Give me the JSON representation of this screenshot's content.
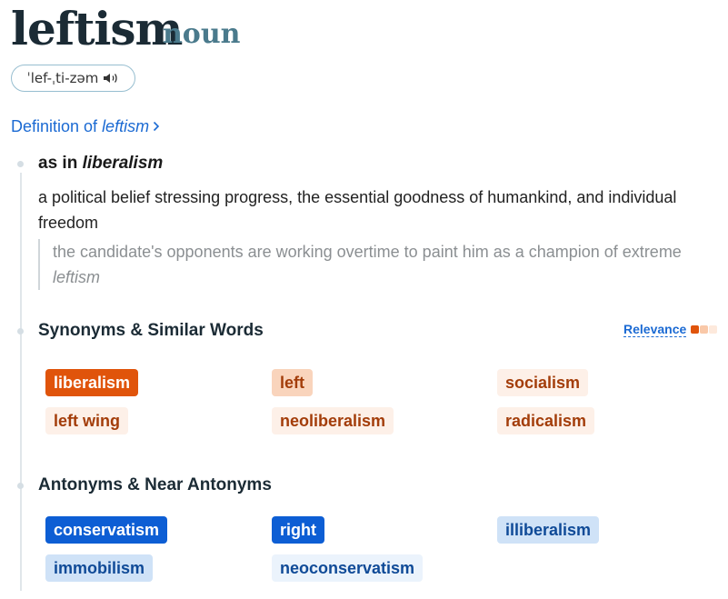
{
  "entry": {
    "headword": "leftism",
    "part_of_speech": "noun",
    "pronunciation": "ˈlef-ˌti-zəm",
    "definition_link": {
      "prefix": "Definition of ",
      "word": "leftism"
    }
  },
  "sense": {
    "prefix": "as in ",
    "word": "liberalism",
    "definition": "a political belief stressing progress, the essential goodness of humankind, and individual freedom",
    "example_before": "the candidate's opponents are working overtime to paint him as a champion of extreme ",
    "example_word": "leftism"
  },
  "synonyms": {
    "title": "Synonyms & Similar Words",
    "relevance_label": "Relevance",
    "relevance_colors": [
      "#e0540b",
      "#f9c8a8",
      "#fde9dc"
    ],
    "words": [
      {
        "word": "liberalism",
        "relevance": "high"
      },
      {
        "word": "left",
        "relevance": "medium"
      },
      {
        "word": "socialism",
        "relevance": "low"
      },
      {
        "word": "left wing",
        "relevance": "low"
      },
      {
        "word": "neoliberalism",
        "relevance": "low"
      },
      {
        "word": "radicalism",
        "relevance": "low"
      }
    ]
  },
  "antonyms": {
    "title": "Antonyms & Near Antonyms",
    "words": [
      {
        "word": "conservatism",
        "relevance": "high"
      },
      {
        "word": "right",
        "relevance": "high"
      },
      {
        "word": "illiberalism",
        "relevance": "medium"
      },
      {
        "word": "immobilism",
        "relevance": "medium"
      },
      {
        "word": "neoconservatism",
        "relevance": "low"
      }
    ]
  },
  "icons": {
    "pronunciation_audio": "speaker-icon",
    "definition_link": "chevron-right-icon"
  }
}
